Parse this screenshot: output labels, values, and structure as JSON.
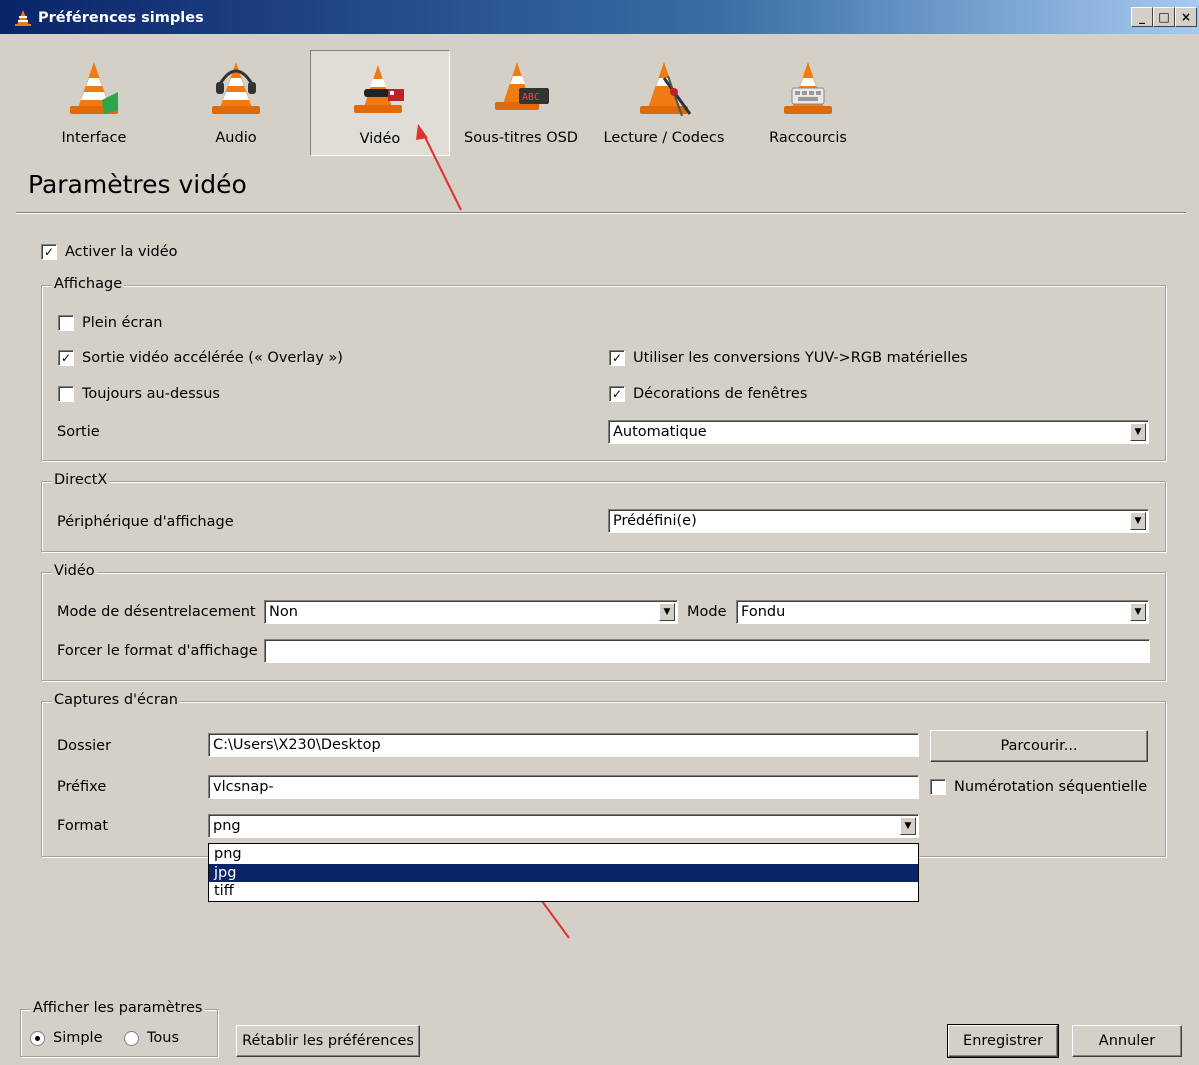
{
  "window": {
    "title": "Préférences simples",
    "min": "_",
    "max": "□",
    "close": "×"
  },
  "tabs": [
    {
      "label": "Interface",
      "selected": false
    },
    {
      "label": "Audio",
      "selected": false
    },
    {
      "label": "Vidéo",
      "selected": true
    },
    {
      "label": "Sous-titres  OSD",
      "selected": false
    },
    {
      "label": "Lecture / Codecs",
      "selected": false
    },
    {
      "label": "Raccourcis",
      "selected": false
    }
  ],
  "page_title": "Paramètres vidéo",
  "enable_video": {
    "label": "Activer la vidéo",
    "checked": true
  },
  "affichage": {
    "title": "Affichage",
    "fullscreen": {
      "label": "Plein écran",
      "checked": false
    },
    "overlay": {
      "label": "Sortie vidéo accélérée (« Overlay »)",
      "checked": true
    },
    "always_on_top": {
      "label": "Toujours au-dessus",
      "checked": false
    },
    "yuv_rgb": {
      "label": "Utiliser les conversions YUV->RGB matérielles",
      "checked": true
    },
    "decorations": {
      "label": "Décorations de fenêtres",
      "checked": true
    },
    "output_label": "Sortie",
    "output_value": "Automatique"
  },
  "directx": {
    "title": "DirectX",
    "device_label": "Périphérique d'affichage",
    "device_value": "Prédéfini(e)"
  },
  "video": {
    "title": "Vidéo",
    "deinterlace_label": "Mode de désentrelacement",
    "deinterlace_value": "Non",
    "mode_label": "Mode",
    "mode_value": "Fondu",
    "aspect_label": "Forcer le format d'affichage",
    "aspect_value": ""
  },
  "snapshots": {
    "title": "Captures d'écran",
    "folder_label": "Dossier",
    "folder_value": "C:\\Users\\X230\\Desktop",
    "browse_button": "Parcourir...",
    "prefix_label": "Préfixe",
    "prefix_value": "vlcsnap-",
    "sequential": {
      "label": "Numérotation séquentielle",
      "checked": false
    },
    "format_label": "Format",
    "format_value": "png",
    "format_options": [
      "png",
      "jpg",
      "tiff"
    ],
    "format_highlighted": "jpg"
  },
  "show_settings": {
    "title": "Afficher les paramètres",
    "simple": "Simple",
    "all": "Tous",
    "selected": "Simple"
  },
  "buttons": {
    "reset": "Rétablir les préférences",
    "save": "Enregistrer",
    "cancel": "Annuler"
  },
  "colors": {
    "window_bg": "#d4d0c8",
    "titlebar": "#0a246a",
    "highlight": "#0a246a",
    "annotation_arrow": "#e03030",
    "cone_orange": "#f07b12"
  }
}
